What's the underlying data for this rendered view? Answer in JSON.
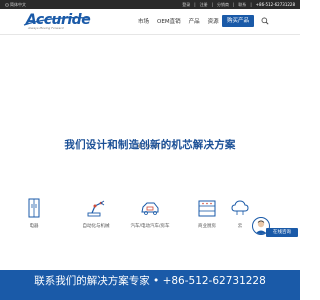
{
  "topbar": {
    "language": "简体中文",
    "links": [
      "登录",
      "注册",
      "分销商",
      "联系"
    ],
    "phone": "+86-512-62731228"
  },
  "header": {
    "logo_text": "Accuride",
    "logo_tagline": "Always Moving Forward",
    "nav": [
      "市场",
      "OEM直销",
      "产品",
      "资源"
    ],
    "products_button": "购买产品"
  },
  "carousel": {
    "slides": 4,
    "active_index": 0
  },
  "solutions": {
    "title": "我们设计和制造创新的机芯解决方案",
    "industries": [
      {
        "label": "电器",
        "icon": "appliance-icon"
      },
      {
        "label": "自动化与机械",
        "icon": "robot-arm-icon"
      },
      {
        "label": "汽车/电动汽车/房车",
        "icon": "vehicle-icon"
      },
      {
        "label": "商业厨房",
        "icon": "kitchen-icon"
      },
      {
        "label": "云",
        "icon": "cloud-icon"
      }
    ]
  },
  "chat": {
    "label": "在线咨询"
  },
  "contact": {
    "text": "联系我们的解决方案专家 • +86-512-62731228"
  },
  "colors": {
    "brand_blue": "#1a5aa8",
    "topbar_bg": "#2a2a2a"
  }
}
